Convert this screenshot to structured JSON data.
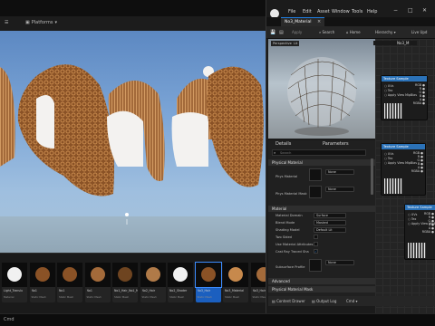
{
  "viewport": {
    "menu_icon": "hamburger-icon",
    "platforms_label": "Platforms"
  },
  "content_drawer": {
    "assets": [
      {
        "name": "Light_Translu",
        "sub": "Material"
      },
      {
        "name": "No1",
        "sub": "Static Mesh"
      },
      {
        "name": "No1",
        "sub": "Static Mesh"
      },
      {
        "name": "No1",
        "sub": "Static Mesh"
      },
      {
        "name": "No1_Hair_No1_Material",
        "sub": "Static Mesh"
      },
      {
        "name": "No2_Hair",
        "sub": "Static Mesh"
      },
      {
        "name": "No2_Shader",
        "sub": "Static Mesh"
      },
      {
        "name": "No3_Hair",
        "sub": "Static Mesh"
      },
      {
        "name": "No3_Material",
        "sub": "Static Mesh"
      },
      {
        "name": "No3_Hair",
        "sub": "Static Mesh"
      },
      {
        "name": "No3_Hair",
        "sub": "Static Mesh"
      }
    ]
  },
  "status_bar": {
    "label": "Cmd"
  },
  "material_editor": {
    "menu": [
      "File",
      "Edit",
      "Asset",
      "Window",
      "Tools",
      "Help"
    ],
    "tab_title": "No3_Material",
    "tab_title_right": "No3_M",
    "toolbar": {
      "apply": "Apply",
      "search": "Search",
      "home": "Home",
      "hierarchy": "Hierarchy",
      "live_update": "Live Upd"
    },
    "preview": {
      "perspective": "Perspective",
      "lit": "Lit"
    },
    "details_tabs": {
      "details": "Details",
      "parameters": "Parameters"
    },
    "search_placeholder": "Search",
    "sections": {
      "physical": "Physical Material",
      "material": "Material",
      "advanced": "Advanced",
      "physical_mask": "Physical Material Mask"
    },
    "props": {
      "phys_material": "Phys Material",
      "phys_material_mask": "Phys Material Mask",
      "material_domain": "Material Domain",
      "blend_mode": "Blend Mode",
      "shading_model": "Shading Model",
      "two_sided": "Two Sided",
      "use_material_attributes": "Use Material Attributes",
      "cast_ray_traced_shadows": "Cast Ray Traced Sha",
      "subsurface_profile": "Subsurface Profile"
    },
    "values": {
      "none": "None",
      "surface": "Surface",
      "masked": "Masked",
      "default_lit": "Default Lit"
    },
    "nodes": [
      {
        "title": "Texture Sample",
        "pins": [
          "UVs",
          "Tex",
          "Apply View MipBias"
        ],
        "outputs": [
          "RGB",
          "R",
          "G",
          "B",
          "A",
          "RGBA"
        ]
      },
      {
        "title": "Texture Sample",
        "pins": [
          "UVs",
          "Tex",
          "Apply View MipBias"
        ],
        "outputs": [
          "RGB",
          "R",
          "G",
          "B",
          "A",
          "RGBA"
        ]
      },
      {
        "title": "Texture Sample",
        "pins": [
          "UVs",
          "Tex",
          "Apply View MipBias"
        ],
        "outputs": [
          "RGB",
          "R",
          "G",
          "B",
          "A",
          "RGBA"
        ]
      }
    ],
    "bottom": {
      "content_drawer": "Content Drawer",
      "output_log": "Output Log",
      "cmd": "Cmd"
    }
  }
}
